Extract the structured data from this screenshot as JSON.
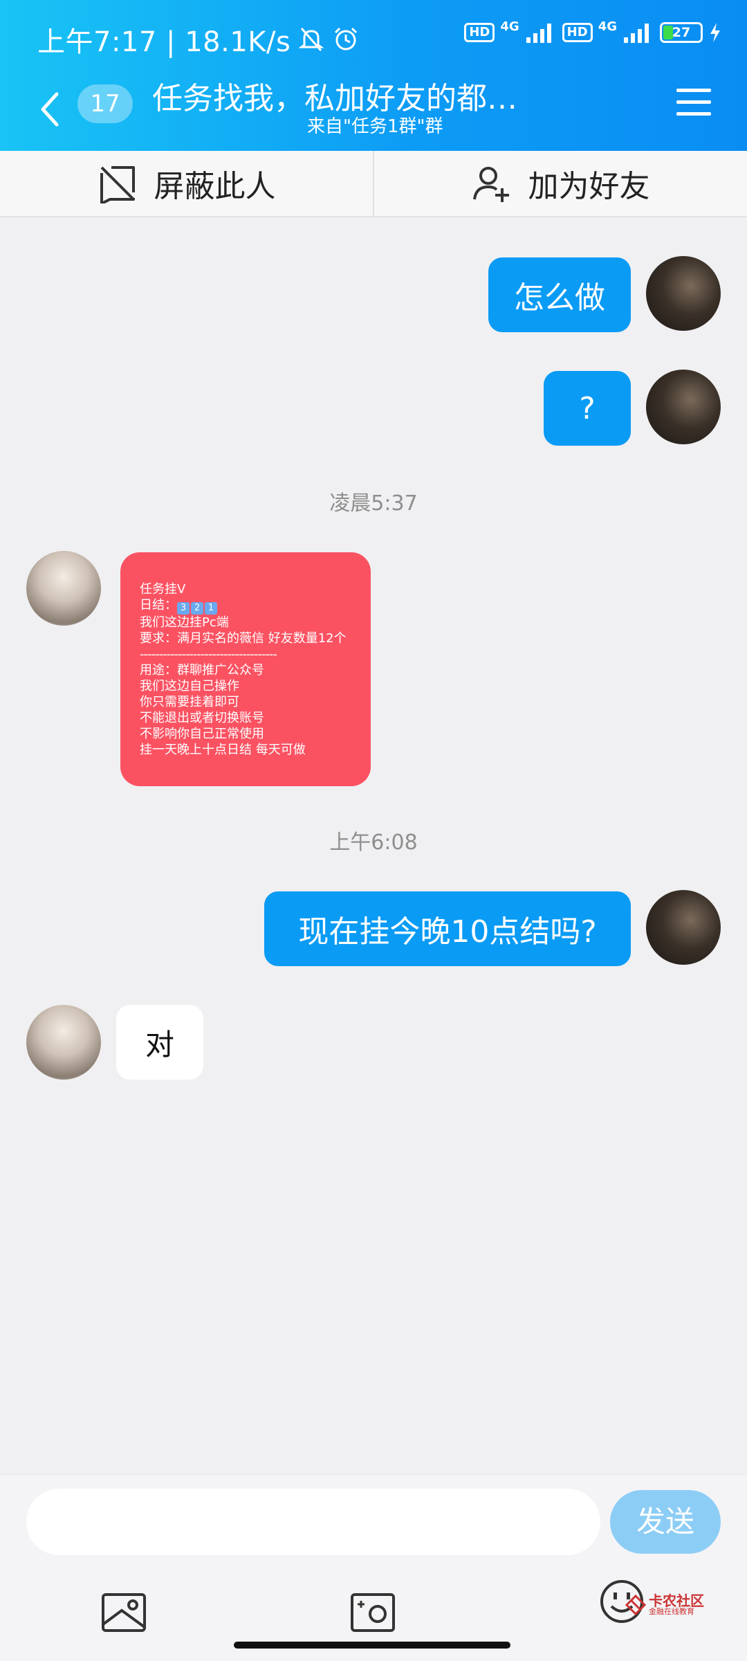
{
  "status": {
    "time": "上午7:17 | 18.1K/s",
    "sim1_badge": "HD",
    "sim1_net": "4G",
    "sim2_badge": "HD",
    "sim2_net": "4G",
    "battery": "27",
    "battery_level": 0.27
  },
  "nav": {
    "unread_count": "17",
    "title": "任务找我，私加好友的都…",
    "subtitle": "来自\"任务1群\"群"
  },
  "actions": {
    "block": "屏蔽此人",
    "add_friend": "加为好友"
  },
  "messages": {
    "m1": "怎么做",
    "m2": "?",
    "time1": "凌晨5:37",
    "card": {
      "l1": "任务挂V",
      "l2_prefix": "日结：",
      "l2_keys": [
        "3",
        "2",
        "1"
      ],
      "l3": "我们这边挂Pc端",
      "l4": "要求：满月实名的薇信 好友数量12个",
      "sep": "------------------------------------",
      "l5": "用途：群聊推广公众号",
      "l6": "我们这边自己操作",
      "l7": "你只需要挂着即可",
      "l8": "不能退出或者切换账号",
      "l9": "不影响你自己正常使用",
      "l10": "挂一天晚上十点日结  每天可做"
    },
    "time2": "上午6:08",
    "m3": "现在挂今晚10点结吗?",
    "m4": "对"
  },
  "composer": {
    "placeholder": "",
    "send": "发送"
  },
  "watermark": {
    "name": "卡农社区",
    "tagline": "金融在线教育"
  }
}
